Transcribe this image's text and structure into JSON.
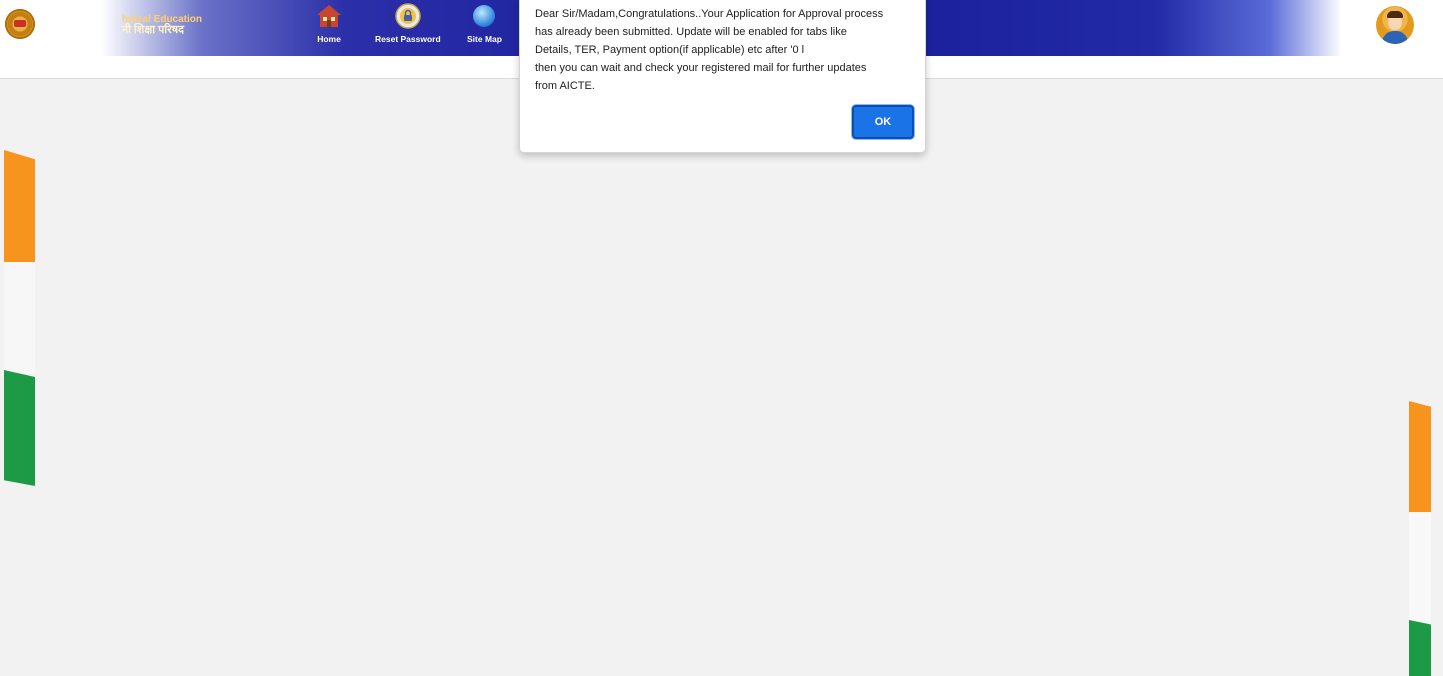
{
  "header": {
    "brand_line1": "hnical Education",
    "brand_line2": "नी शिक्षा परिषद",
    "nav": [
      {
        "label": "Home",
        "icon": "home-icon"
      },
      {
        "label": "Reset Password",
        "icon": "lock-icon"
      },
      {
        "label": "Site Map",
        "icon": "globe-icon"
      }
    ],
    "logo_icon": "aicte-logo-icon",
    "avatar_icon": "user-avatar-icon"
  },
  "dialog": {
    "message": "Dear Sir/Madam,Congratulations..Your Application for Approval process\nhas already been submitted. Update will be enabled for tabs like\nDetails, TER, Payment  option(if applicable) etc after '0                     l\nthen you can wait and check your registered mail for further updates\nfrom AICTE.",
    "ok_label": "OK"
  },
  "colors": {
    "header_blue": "#1e23a0",
    "saffron": "#f7941d",
    "green": "#1d9a46",
    "ok_button": "#1b73e8",
    "background": "#f2f2f2"
  }
}
